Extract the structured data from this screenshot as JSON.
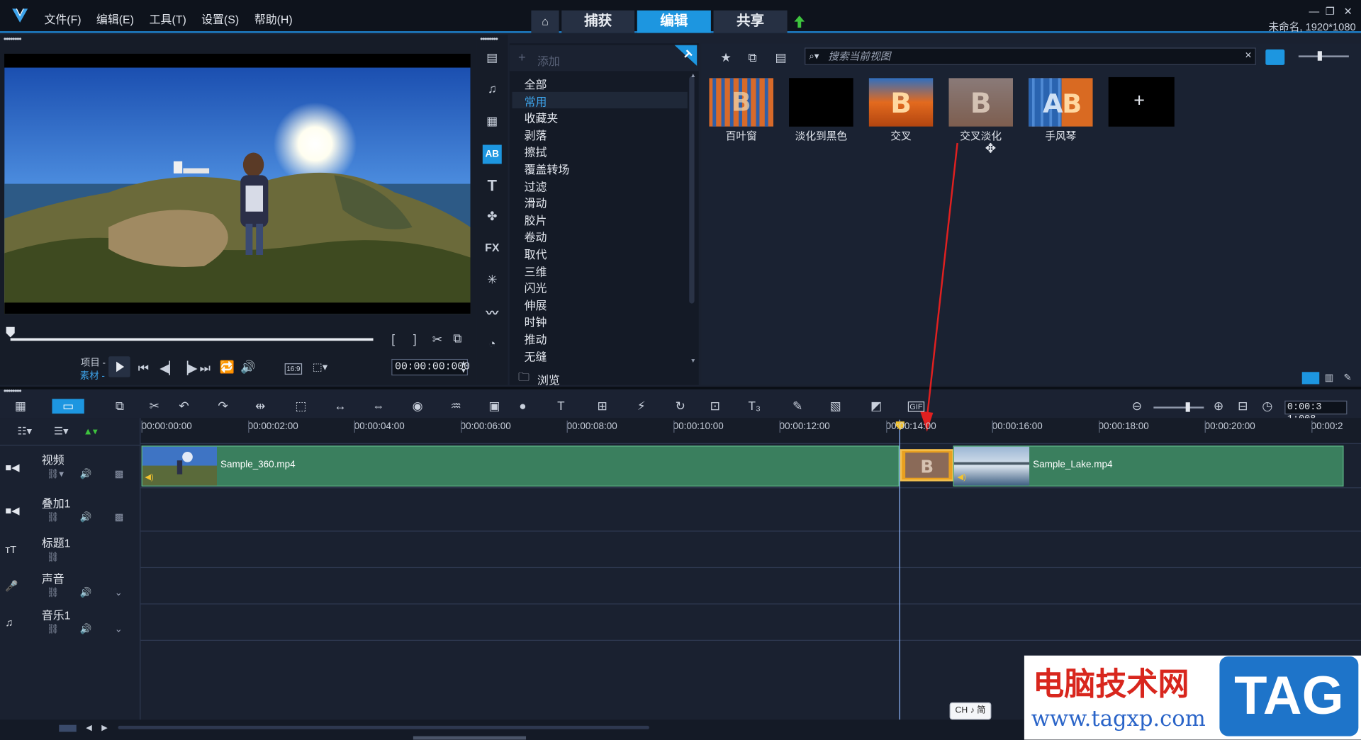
{
  "menu": {
    "items": [
      "文件(F)",
      "编辑(E)",
      "工具(T)",
      "设置(S)",
      "帮助(H)"
    ]
  },
  "mode_tabs": [
    "捕获",
    "编辑",
    "共享"
  ],
  "window": {
    "title": "未命名, 1920*1080"
  },
  "preview": {
    "label_project": "项目 -",
    "label_clip": "素材 -",
    "aspect": "16:9",
    "timecode": "00:00:00:000"
  },
  "library": {
    "add_label": "添加",
    "categories": [
      "全部",
      "常用",
      "收藏夹",
      "剥落",
      "擦拭",
      "覆盖转场",
      "过滤",
      "滑动",
      "胶片",
      "卷动",
      "取代",
      "三维",
      "闪光",
      "伸展",
      "时钟",
      "推动",
      "无缝"
    ],
    "selected_category": "常用",
    "browse_label": "浏览",
    "search_placeholder": "搜索当前视图",
    "thumbnails": [
      "百叶窗",
      "淡化到黑色",
      "交叉",
      "交叉淡化",
      "手风琴"
    ]
  },
  "timeline": {
    "zoom_timecode": "0:00:3 1:008",
    "ruler_ticks": [
      "00:00:00:00",
      "00:00:02:00",
      "00:00:04:00",
      "00:00:06:00",
      "00:00:08:00",
      "00:00:10:00",
      "00:00:12:00",
      "00:00:14:00",
      "00:00:16:00",
      "00:00:18:00",
      "00:00:20:00",
      "00:00:2"
    ],
    "tracks": [
      "视频",
      "叠加1",
      "标题1",
      "声音",
      "音乐1"
    ],
    "clips": [
      "Sample_360.mp4",
      "Sample_Lake.mp4"
    ]
  },
  "watermark": {
    "title": "电脑技术网",
    "url": "www.tagxp.com",
    "tag": "TAG"
  },
  "ime": "CH ♪ 简",
  "colors": {
    "accent": "#1d96e0",
    "clip": "#3a7f5e",
    "arrow": "#e02020"
  }
}
